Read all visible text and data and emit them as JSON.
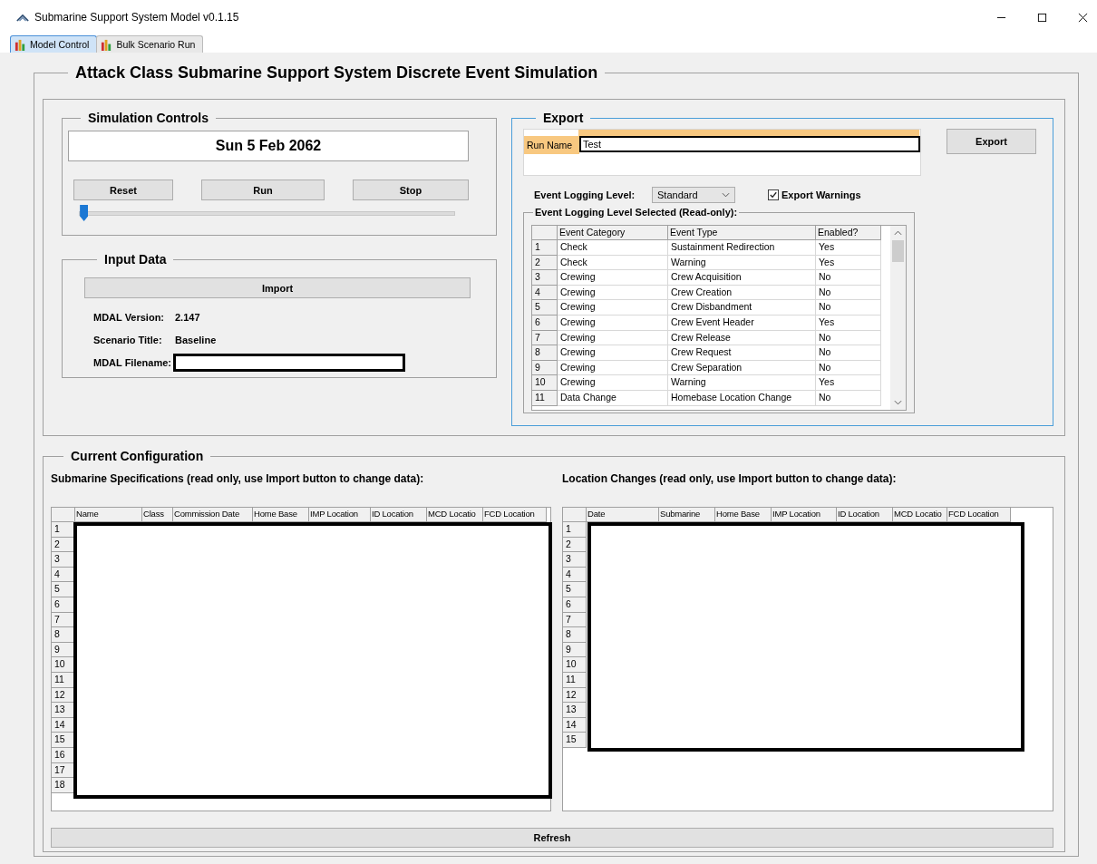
{
  "window": {
    "title": "Submarine Support System Model v0.1.15"
  },
  "tabs": [
    {
      "label": "Model Control",
      "selected": true
    },
    {
      "label": "Bulk Scenario Run",
      "selected": false
    }
  ],
  "heading": "Attack Class Submarine Support System Discrete Event Simulation",
  "simulation_controls": {
    "title": "Simulation Controls",
    "date": "Sun 5 Feb 2062",
    "buttons": [
      "Reset",
      "Run",
      "Stop"
    ],
    "slider": {
      "level": 0.01
    }
  },
  "input_data": {
    "title": "Input Data",
    "import_button": "Import",
    "fields": [
      {
        "label": "MDAL Version:",
        "value": "2.147"
      },
      {
        "label": "Scenario Title:",
        "value": "Baseline"
      },
      {
        "label": "MDAL Filename:",
        "redacted": true
      }
    ]
  },
  "export": {
    "title": "Export",
    "run_name": {
      "label": "Run Name",
      "value": "Test"
    },
    "export_button": "Export",
    "logging_level": {
      "label": "Event Logging Level:",
      "value": "Standard"
    },
    "export_warnings": {
      "label": "Export Warnings",
      "checked": true
    },
    "table": {
      "title": "Event Logging Level Selected (Read-only):",
      "columns": [
        "Event Category",
        "Event Type",
        "Enabled?"
      ],
      "rows": [
        {
          "index": "1",
          "cells": [
            "Check",
            "Sustainment Redirection",
            "Yes"
          ]
        },
        {
          "index": "2",
          "cells": [
            "Check",
            "Warning",
            "Yes"
          ]
        },
        {
          "index": "3",
          "cells": [
            "Crewing",
            "Crew Acquisition",
            "No"
          ]
        },
        {
          "index": "4",
          "cells": [
            "Crewing",
            "Crew Creation",
            "No"
          ]
        },
        {
          "index": "5",
          "cells": [
            "Crewing",
            "Crew Disbandment",
            "No"
          ]
        },
        {
          "index": "6",
          "cells": [
            "Crewing",
            "Crew Event Header",
            "Yes"
          ]
        },
        {
          "index": "7",
          "cells": [
            "Crewing",
            "Crew Release",
            "No"
          ]
        },
        {
          "index": "8",
          "cells": [
            "Crewing",
            "Crew Request",
            "No"
          ]
        },
        {
          "index": "9",
          "cells": [
            "Crewing",
            "Crew Separation",
            "No"
          ]
        },
        {
          "index": "10",
          "cells": [
            "Crewing",
            "Warning",
            "Yes"
          ]
        },
        {
          "index": "11",
          "cells": [
            "Data Change",
            "Homebase Location Change",
            "No"
          ]
        }
      ]
    }
  },
  "current_configuration": {
    "title": "Current Configuration",
    "submarine_specifications": {
      "title": "Submarine Specifications (read only, use Import button to change data):",
      "redacted": true,
      "columns": [
        "Name",
        "Class",
        "Commission Date",
        "Home Base",
        "IMP Location",
        "ID Location",
        "MCD Locatio",
        "FCD Location"
      ],
      "row_numbers": [
        "1",
        "2",
        "3",
        "4",
        "5",
        "6",
        "7",
        "8",
        "9",
        "10",
        "11",
        "12",
        "13",
        "14",
        "15",
        "16",
        "17",
        "18"
      ]
    },
    "location_changes": {
      "title": "Location Changes (read only, use Import button to change data):",
      "redacted": true,
      "columns": [
        "Date",
        "Submarine",
        "Home Base",
        "IMP Location",
        "ID Location",
        "MCD Locatio",
        "FCD Location"
      ],
      "row_numbers": [
        "1",
        "2",
        "3",
        "4",
        "5",
        "6",
        "7",
        "8",
        "9",
        "10",
        "11",
        "12",
        "13",
        "14",
        "15"
      ]
    },
    "refresh_button": "Refresh"
  }
}
